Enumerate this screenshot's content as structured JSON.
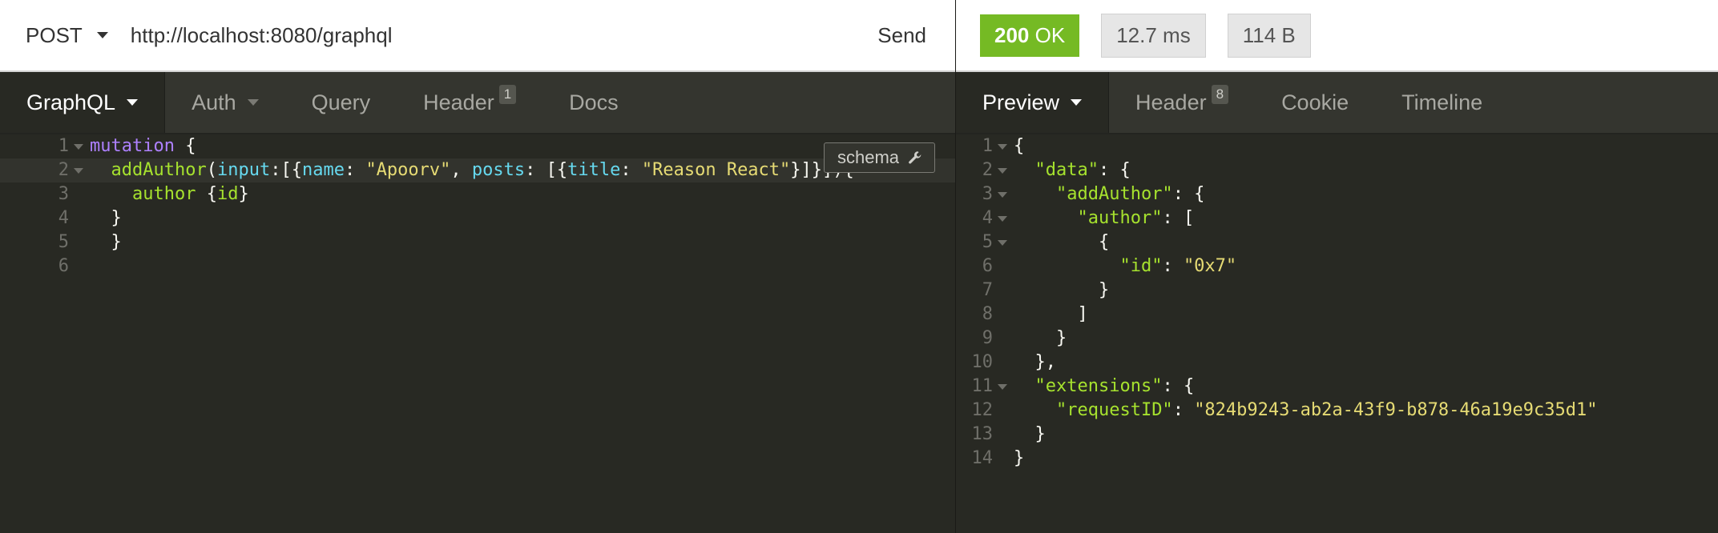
{
  "request": {
    "method": "POST",
    "url": "http://localhost:8080/graphql",
    "send_label": "Send",
    "tabs": [
      {
        "label": "GraphQL",
        "active": true,
        "dropdown": true
      },
      {
        "label": "Auth",
        "dropdown": true
      },
      {
        "label": "Query"
      },
      {
        "label": "Header",
        "badge": "1"
      },
      {
        "label": "Docs"
      }
    ],
    "schema_button": "schema",
    "editor_lines": [
      {
        "num": "1",
        "text": "mutation {"
      },
      {
        "num": "2",
        "text": "  addAuthor(input:[{name: \"Apoorv\", posts: [{title: \"Reason React\"}]}]){"
      },
      {
        "num": "3",
        "text": "    author {id}"
      },
      {
        "num": "4",
        "text": "  }"
      },
      {
        "num": "5",
        "text": "  }"
      },
      {
        "num": "6",
        "text": ""
      }
    ]
  },
  "response": {
    "status_code": "200",
    "status_text": "OK",
    "time": "12.7 ms",
    "size": "114 B",
    "tabs": [
      {
        "label": "Preview",
        "active": true,
        "dropdown": true
      },
      {
        "label": "Header",
        "badge": "8"
      },
      {
        "label": "Cookie"
      },
      {
        "label": "Timeline"
      }
    ],
    "body_lines": [
      {
        "num": "1",
        "text": "{"
      },
      {
        "num": "2",
        "text": "  \"data\": {"
      },
      {
        "num": "3",
        "text": "    \"addAuthor\": {"
      },
      {
        "num": "4",
        "text": "      \"author\": ["
      },
      {
        "num": "5",
        "text": "        {"
      },
      {
        "num": "6",
        "text": "          \"id\": \"0x7\""
      },
      {
        "num": "7",
        "text": "        }"
      },
      {
        "num": "8",
        "text": "      ]"
      },
      {
        "num": "9",
        "text": "    }"
      },
      {
        "num": "10",
        "text": "  },"
      },
      {
        "num": "11",
        "text": "  \"extensions\": {"
      },
      {
        "num": "12",
        "text": "    \"requestID\": \"824b9243-ab2a-43f9-b878-46a19e9c35d1\""
      },
      {
        "num": "13",
        "text": "  }"
      },
      {
        "num": "14",
        "text": "}"
      }
    ]
  },
  "colors": {
    "status_ok": "#75ba24",
    "editor_bg": "#282923",
    "keyword": "#ae81ff",
    "function": "#a6e22e",
    "argument": "#66d9ef",
    "string": "#e6db74"
  },
  "icons": {
    "method_dropdown": "chevron-down-icon",
    "schema": "wrench-icon",
    "fold": "fold-arrow-icon"
  }
}
